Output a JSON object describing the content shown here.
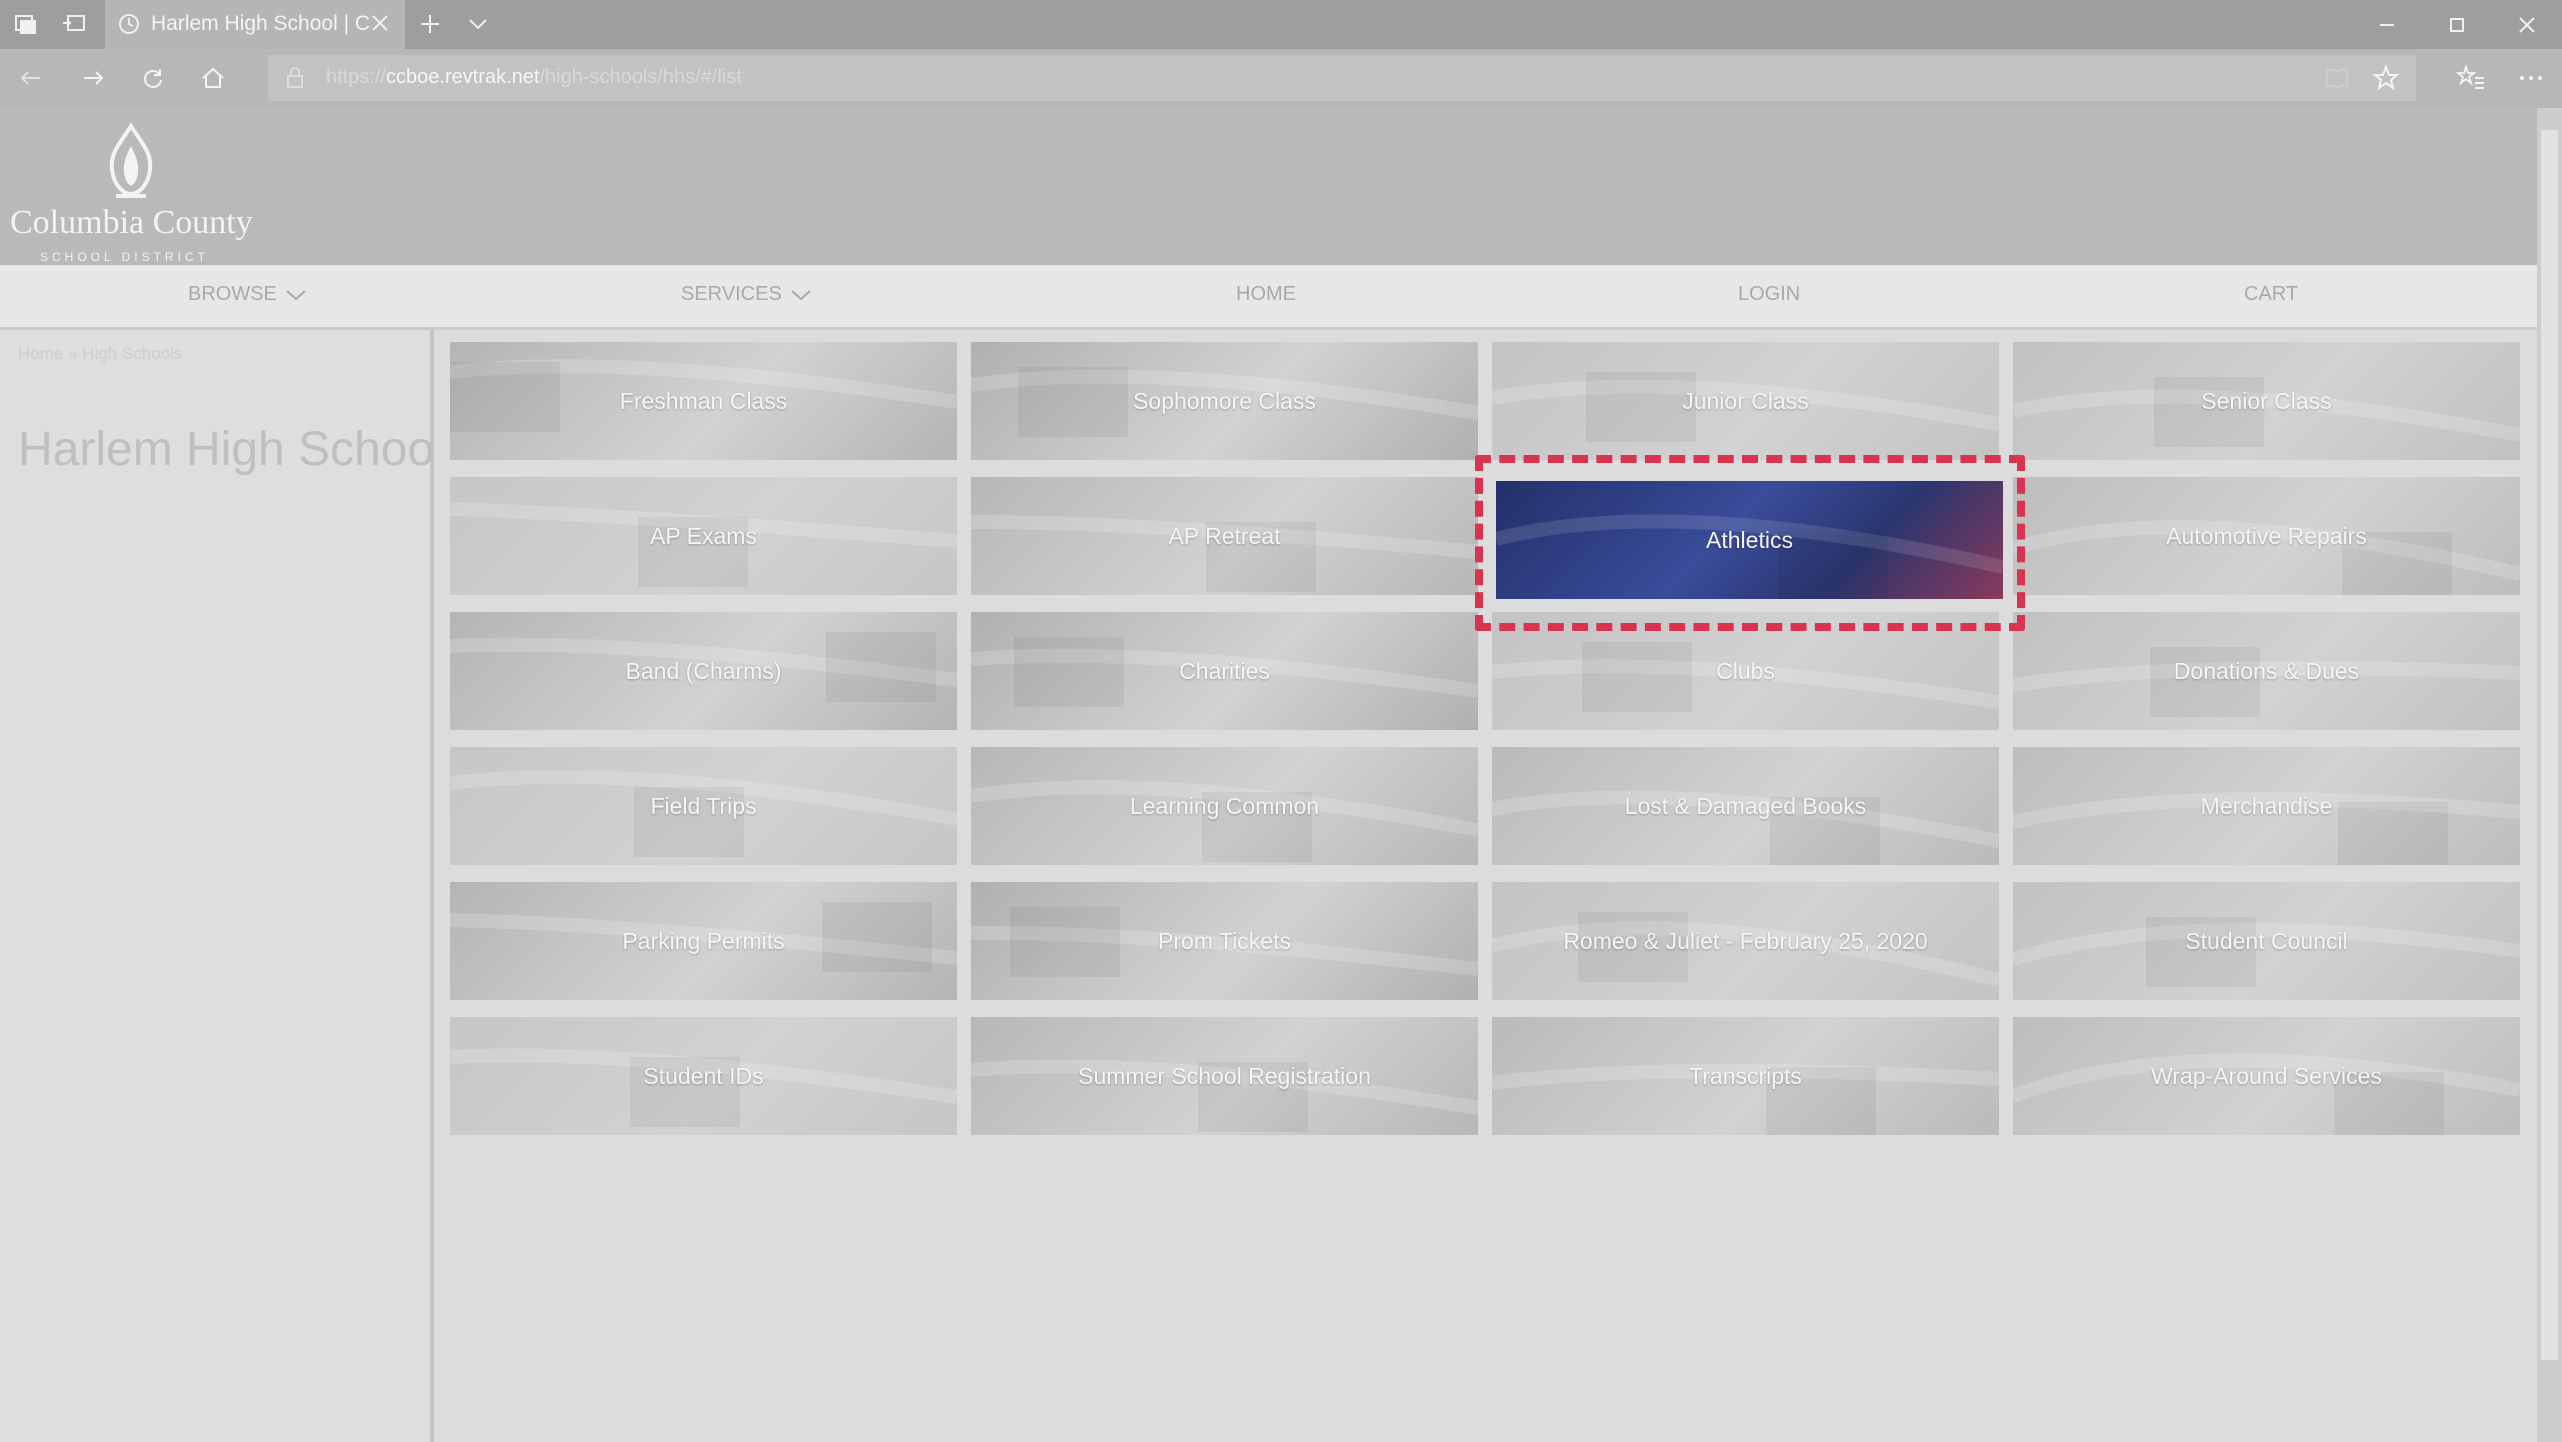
{
  "browser": {
    "tab_title": "Harlem High School | C",
    "url_prefix": "https://",
    "url_domain": "ccboe.revtrak.net",
    "url_path": "/high-schools/hhs/#/list"
  },
  "site": {
    "logo_name": "Columbia County",
    "logo_sub": "SCHOOL DISTRICT"
  },
  "nav": {
    "browse": "BROWSE",
    "services": "SERVICES",
    "home": "HOME",
    "login": "LOGIN",
    "cart": "CART"
  },
  "sidebar": {
    "breadcrumb": "Home » High Schools",
    "title": "Harlem High School"
  },
  "tiles": [
    "Freshman Class",
    "Sophomore Class",
    "Junior Class",
    "Senior Class",
    "AP Exams",
    "AP Retreat",
    "Athletics",
    "Automotive Repairs",
    "Band (Charms)",
    "Charities",
    "Clubs",
    "Donations & Dues",
    "Field Trips",
    "Learning Common",
    "Lost & Damaged Books",
    "Merchandise",
    "Parking Permits",
    "Prom Tickets",
    "Romeo & Juliet - February 25, 2020",
    "Student Council",
    "Student IDs",
    "Summer School Registration",
    "Transcripts",
    "Wrap-Around Services"
  ],
  "highlighted_tile": "Athletics",
  "colors": {
    "highlight_border": "#d9344f",
    "active_tile": "#2e3a78"
  }
}
